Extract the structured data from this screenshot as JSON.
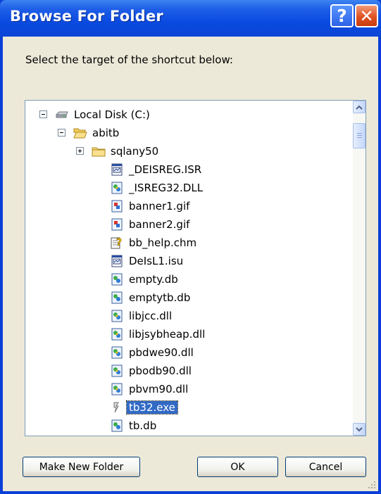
{
  "window": {
    "title": "Browse For Folder",
    "help_symbol": "?",
    "close_symbol": "✕"
  },
  "dialog": {
    "prompt": "Select the target of the shortcut below:"
  },
  "tree": {
    "items": [
      {
        "label": "Local Disk (C:)",
        "icon": "drive-icon",
        "expander": "minus"
      },
      {
        "label": "abitb",
        "icon": "folder-open-icon",
        "expander": "minus"
      },
      {
        "label": "sqlany50",
        "icon": "folder-icon",
        "expander": "plus"
      },
      {
        "label": "_DEISREG.ISR",
        "icon": "setup-file-icon"
      },
      {
        "label": "_ISREG32.DLL",
        "icon": "dll-icon"
      },
      {
        "label": "banner1.gif",
        "icon": "gif-image-icon"
      },
      {
        "label": "banner2.gif",
        "icon": "gif-image-icon"
      },
      {
        "label": "bb_help.chm",
        "icon": "help-file-icon"
      },
      {
        "label": "DeIsL1.isu",
        "icon": "setup-file-icon"
      },
      {
        "label": "empty.db",
        "icon": "generic-file-icon"
      },
      {
        "label": "emptytb.db",
        "icon": "generic-file-icon"
      },
      {
        "label": "libjcc.dll",
        "icon": "dll-icon"
      },
      {
        "label": "libjsybheap.dll",
        "icon": "dll-icon"
      },
      {
        "label": "pbdwe90.dll",
        "icon": "dll-icon"
      },
      {
        "label": "pbodb90.dll",
        "icon": "dll-icon"
      },
      {
        "label": "pbvm90.dll",
        "icon": "dll-icon"
      },
      {
        "label": "tb32.exe",
        "icon": "executable-icon",
        "selected": true
      },
      {
        "label": "tb.db",
        "icon": "generic-file-icon"
      }
    ],
    "scroll_position": 0.08
  },
  "buttons": {
    "new_folder": "Make New Folder",
    "ok": "OK",
    "cancel": "Cancel"
  },
  "colors": {
    "titlebar": "#0a4ae0",
    "selection": "#316ac5",
    "dialog_bg": "#ece9d8"
  }
}
